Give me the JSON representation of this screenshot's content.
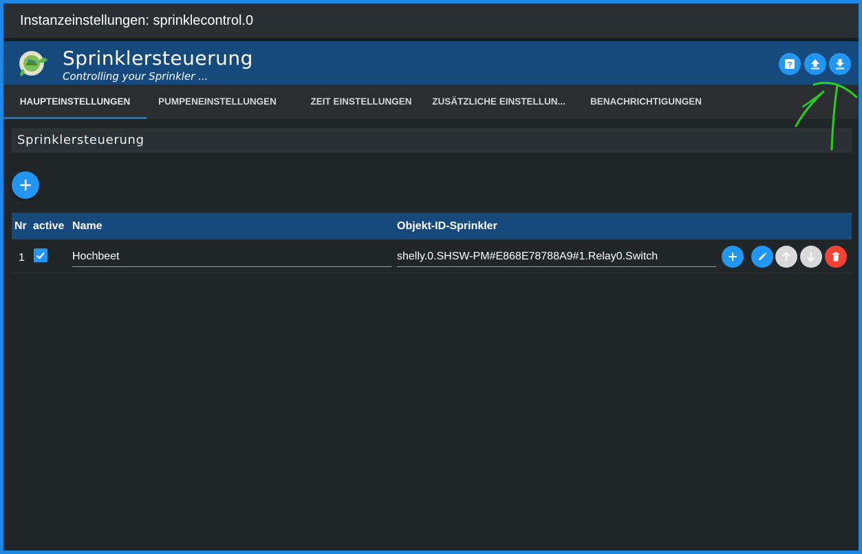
{
  "window": {
    "title": "Instanzeinstellungen: sprinklecontrol.0"
  },
  "header": {
    "title": "Sprinklersteuerung",
    "subtitle": "Controlling your Sprinkler ...",
    "buttons": [
      {
        "icon": "help-icon"
      },
      {
        "icon": "upload-icon"
      },
      {
        "icon": "download-icon"
      }
    ]
  },
  "tabs": [
    {
      "label": "HAUPTEINSTELLUNGEN",
      "active": true
    },
    {
      "label": "PUMPENEINSTELLUNGEN",
      "active": false
    },
    {
      "label": "ZEIT EINSTELLUNGEN",
      "active": false
    },
    {
      "label": "ZUSÄTZLICHE EINSTELLUN...",
      "active": false
    },
    {
      "label": "BENACHRICHTIGUNGEN",
      "active": false
    }
  ],
  "section": {
    "title": "Sprinklersteuerung"
  },
  "table": {
    "columns": [
      "Nr",
      "active",
      "Name",
      "Objekt-ID-Sprinkler"
    ],
    "rows": [
      {
        "nr": "1",
        "active": true,
        "name": "Hochbeet",
        "object_id": "shelly.0.SHSW-PM#E868E78788A9#1.Relay0.Switch"
      }
    ]
  },
  "colors": {
    "accent": "#2196f3",
    "header_bg": "#174a7c",
    "background": "#212629",
    "delete": "#f44336",
    "annotation": "#29d11f"
  }
}
